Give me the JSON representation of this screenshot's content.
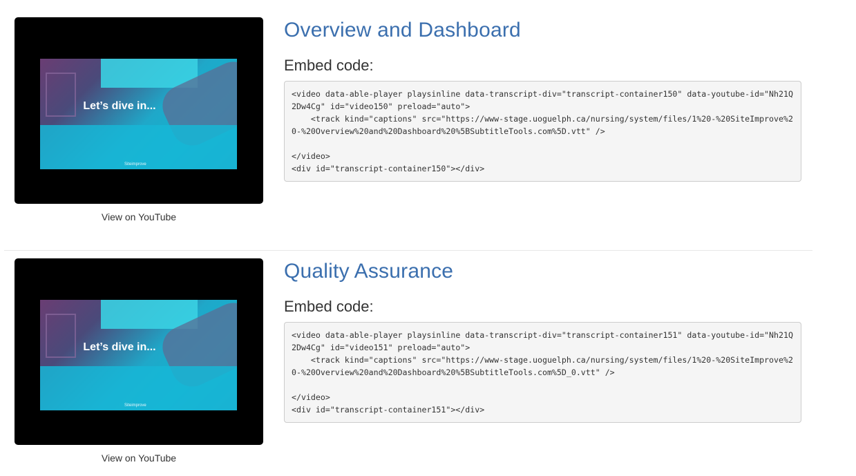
{
  "entries": [
    {
      "title": "Overview and Dashboard",
      "embed_label": "Embed code:",
      "video_overlay_text": "Let’s dive in...",
      "video_brand": "Siteimprove",
      "youtube_link": "View on YouTube",
      "code": "<video data-able-player playsinline data-transcript-div=\"transcript-container150\" data-youtube-id=\"Nh21Q2Dw4Cg\" id=\"video150\" preload=\"auto\">\n    <track kind=\"captions\" src=\"https://www-stage.uoguelph.ca/nursing/system/files/1%20-%20SiteImprove%20-%20Overview%20and%20Dashboard%20%5BSubtitleTools.com%5D.vtt\" />\n\n</video>\n<div id=\"transcript-container150\"></div>"
    },
    {
      "title": "Quality Assurance",
      "embed_label": "Embed code:",
      "video_overlay_text": "Let’s dive in...",
      "video_brand": "Siteimprove",
      "youtube_link": "View on YouTube",
      "code": "<video data-able-player playsinline data-transcript-div=\"transcript-container151\" data-youtube-id=\"Nh21Q2Dw4Cg\" id=\"video151\" preload=\"auto\">\n    <track kind=\"captions\" src=\"https://www-stage.uoguelph.ca/nursing/system/files/1%20-%20SiteImprove%20-%20Overview%20and%20Dashboard%20%5BSubtitleTools.com%5D_0.vtt\" />\n\n</video>\n<div id=\"transcript-container151\"></div>"
    }
  ]
}
